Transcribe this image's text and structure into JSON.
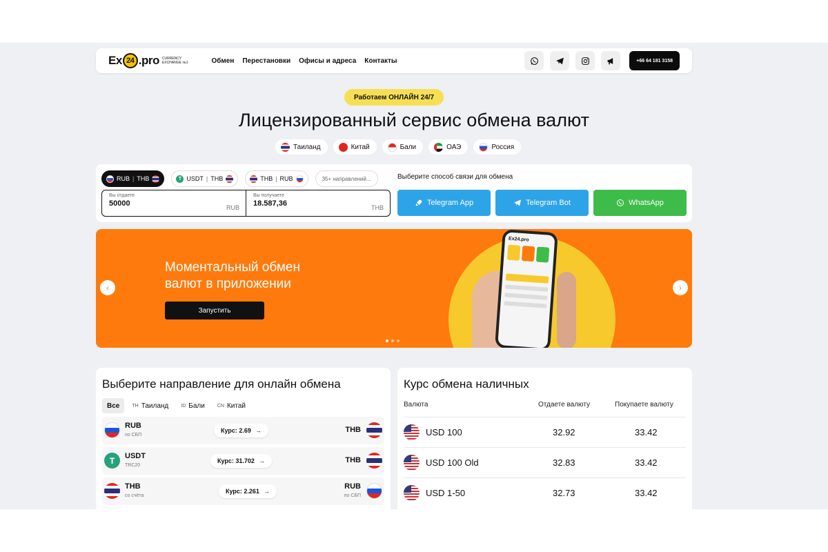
{
  "header": {
    "logo_main": "Ex",
    "logo_num": "24",
    "logo_tld": ".pro",
    "logo_sub1": "Currency",
    "logo_sub2": "Exchange №1",
    "nav": [
      "Обмен",
      "Перестановки",
      "Офисы и адреса",
      "Контакты"
    ],
    "social_icons": [
      "whatsapp-icon",
      "telegram-icon",
      "instagram-icon",
      "megaphone-icon"
    ],
    "phone": "+66 64 181 3158"
  },
  "hero": {
    "badge": "Работаем ОНЛАЙН 24/7",
    "title": "Лицензированный сервис обмена валют",
    "countries": [
      "Таиланд",
      "Китай",
      "Бали",
      "ОАЭ",
      "Россия"
    ]
  },
  "exchange": {
    "pairs": [
      {
        "from": "RUB",
        "to": "THB"
      },
      {
        "from": "USDT",
        "to": "THB"
      },
      {
        "from": "THB",
        "to": "RUB"
      }
    ],
    "more_directions": "35+ направлений...",
    "give_label": "Вы отдаете",
    "give_value": "50000",
    "give_currency": "RUB",
    "get_label": "Вы получаете",
    "get_value": "18.587,36",
    "get_currency": "THB",
    "contact_label": "Выберите способ связи для обмена",
    "buttons": [
      "Telegram App",
      "Telegram Bot",
      "WhatsApp"
    ]
  },
  "banner": {
    "headline_1": "Моментальный обмен",
    "headline_2": "валют в приложении",
    "cta": "Запустить",
    "slides_total": 3,
    "active_slide": 1
  },
  "directions": {
    "title": "Выберите направление для онлайн обмена",
    "filters": [
      {
        "code": "",
        "label": "Все"
      },
      {
        "code": "TH",
        "label": "Таиланд"
      },
      {
        "code": "ID",
        "label": "Бали"
      },
      {
        "code": "CN",
        "label": "Китай"
      }
    ],
    "rows": [
      {
        "from": "RUB",
        "from_sub": "по СБП",
        "rate": "Курс: 2.69",
        "to": "THB",
        "to_sub": ""
      },
      {
        "from": "USDT",
        "from_sub": "TRC20",
        "rate": "Курс: 31.702",
        "to": "THB",
        "to_sub": ""
      },
      {
        "from": "THB",
        "from_sub": "со счёта",
        "rate": "Курс: 2.261",
        "to": "RUB",
        "to_sub": "по СБП"
      }
    ]
  },
  "cash": {
    "title": "Курс обмена наличных",
    "col_currency": "Валюта",
    "col_sell": "Отдаете валюту",
    "col_buy": "Покупаете валюту",
    "rows": [
      {
        "name": "USD 100",
        "sell": "32.92",
        "buy": "33.42"
      },
      {
        "name": "USD 100 Old",
        "sell": "32.83",
        "buy": "33.42"
      },
      {
        "name": "USD 1-50",
        "sell": "32.73",
        "buy": "33.42"
      }
    ]
  }
}
